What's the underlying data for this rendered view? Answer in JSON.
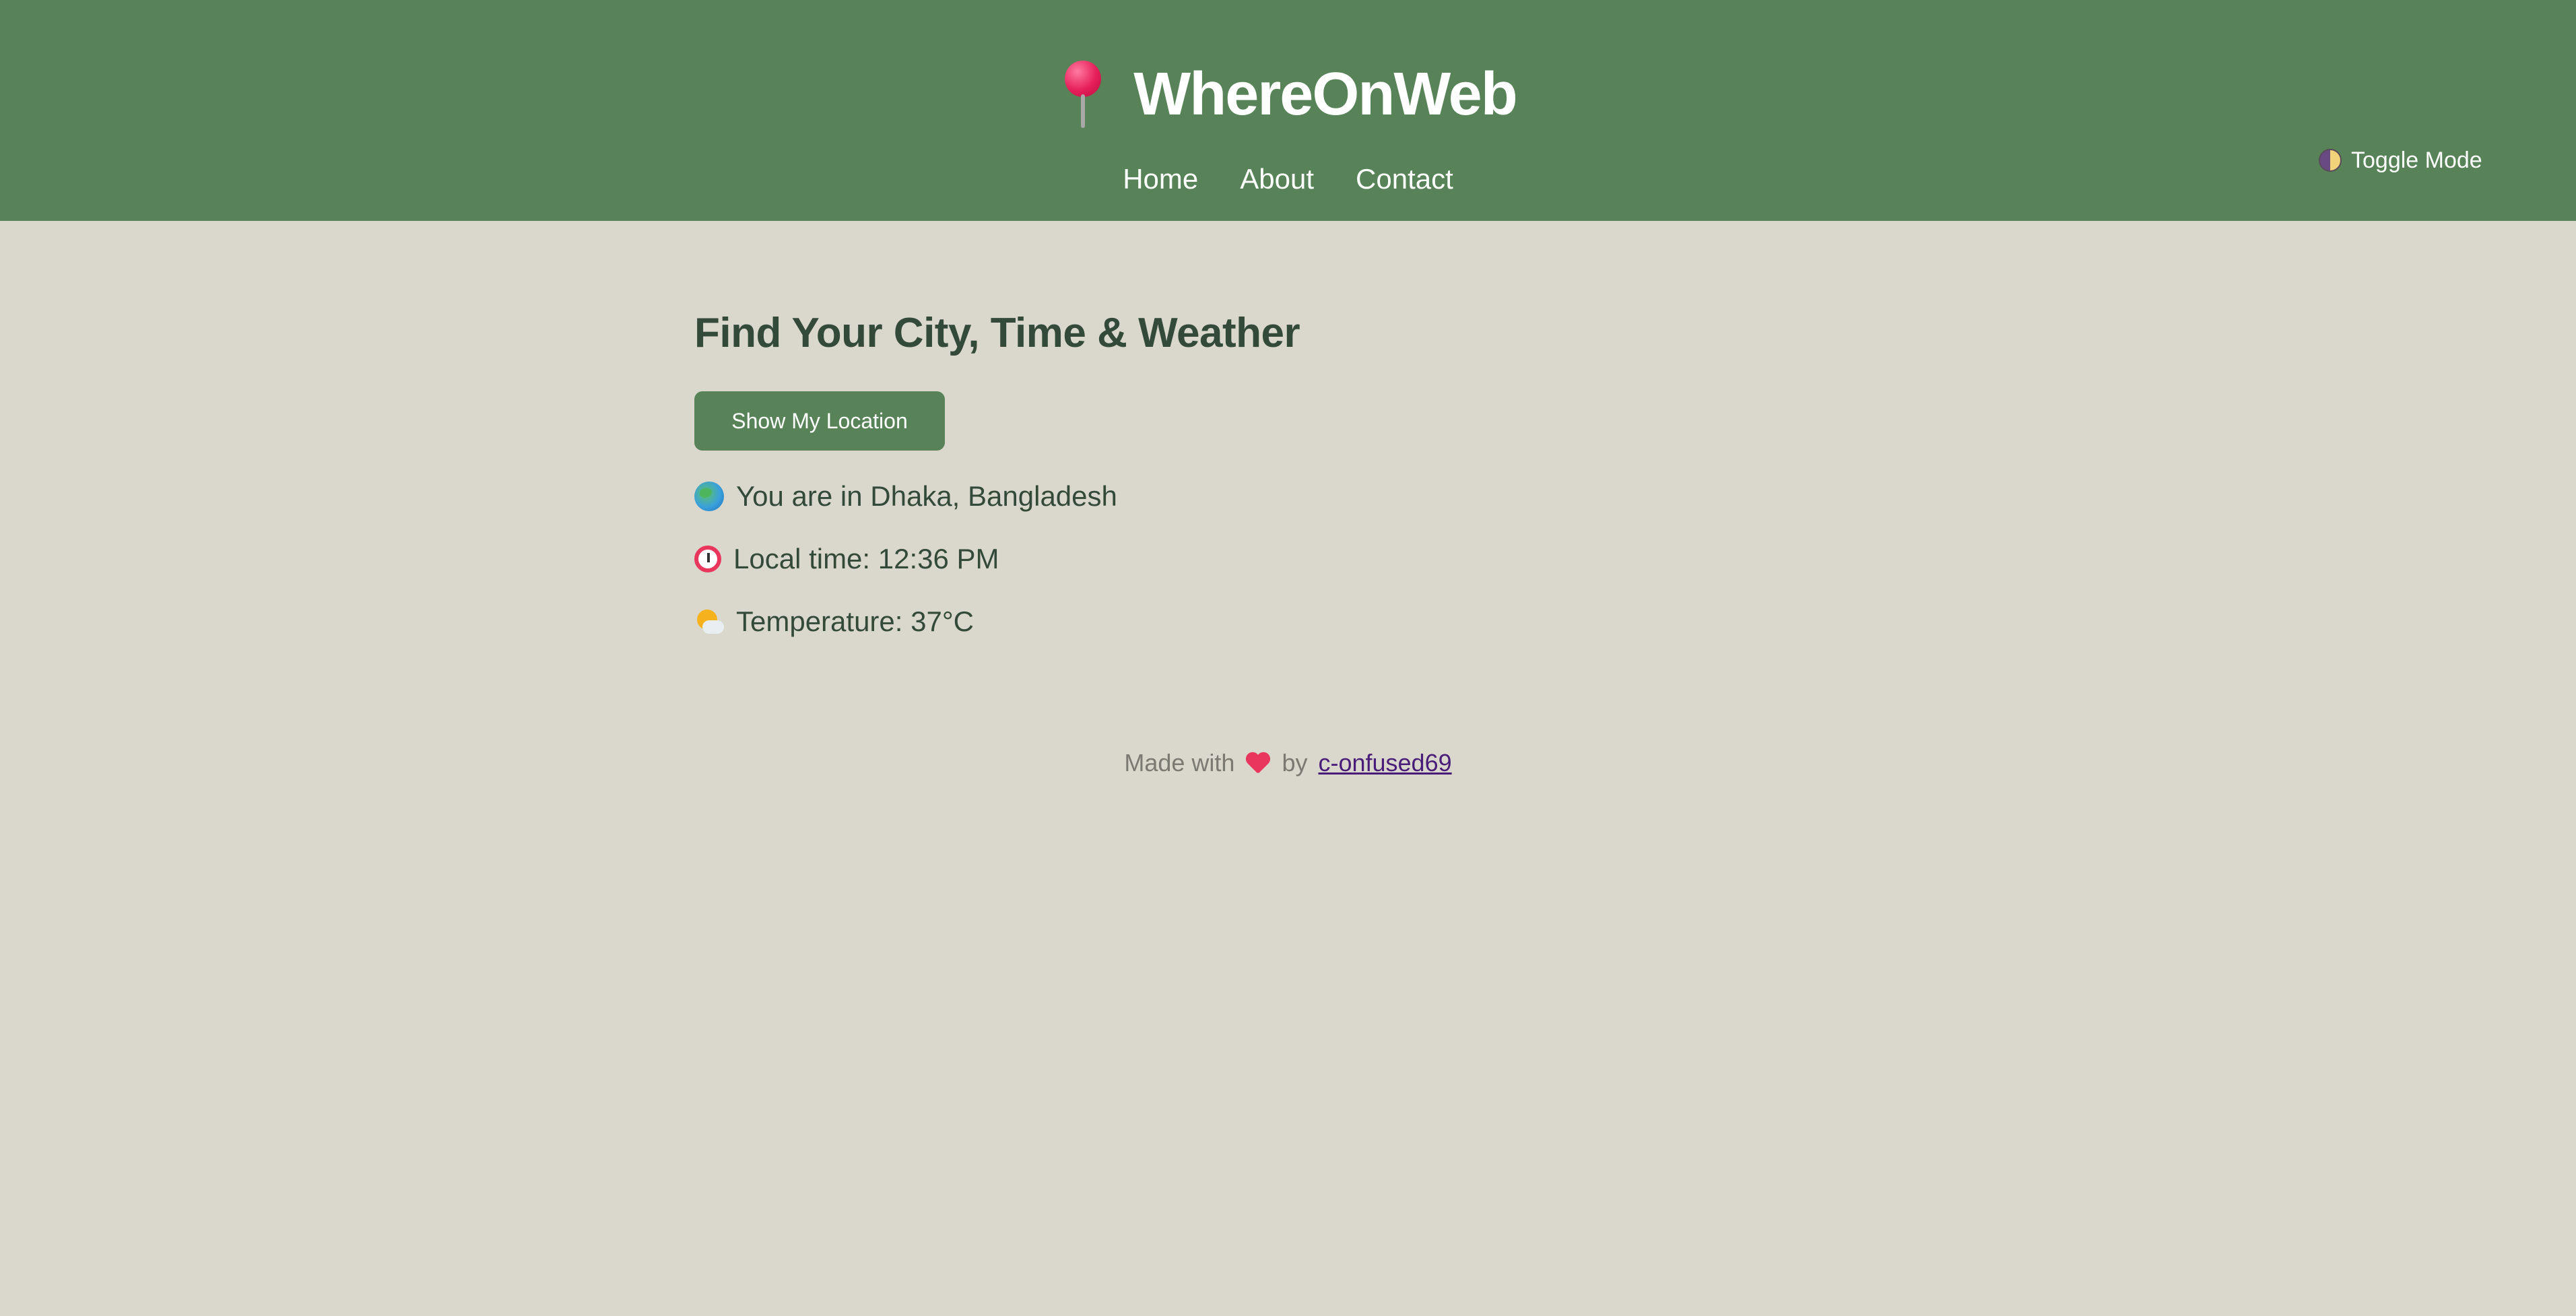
{
  "header": {
    "brand_icon": "round-pushpin-icon",
    "title": "WhereOnWeb",
    "nav": [
      {
        "label": "Home"
      },
      {
        "label": "About"
      },
      {
        "label": "Contact"
      }
    ],
    "toggle": {
      "icon": "half-moon-icon",
      "label": "Toggle Mode"
    }
  },
  "main": {
    "heading": "Find Your City, Time & Weather",
    "button_label": "Show My Location",
    "location_text": "You are in Dhaka, Bangladesh",
    "time_text": "Local time: 12:36 PM",
    "temperature_text": "Temperature: 37°C"
  },
  "footer": {
    "made_with": "Made with",
    "by": "by",
    "author": "c-onfused69"
  },
  "colors": {
    "header_bg": "#588358",
    "page_bg": "#dad8cc",
    "text_dark": "#334a39",
    "link": "#4a1c7a"
  }
}
